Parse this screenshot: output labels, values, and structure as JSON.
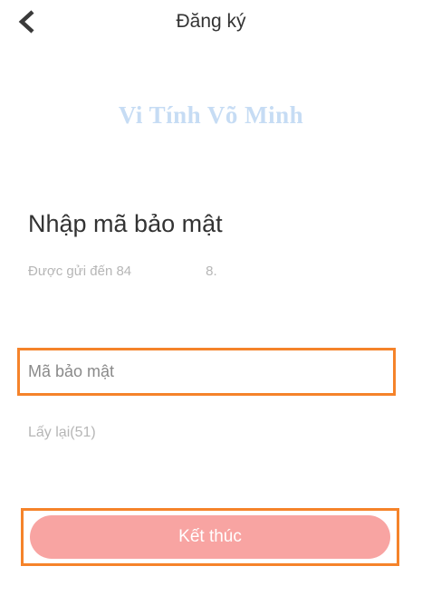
{
  "header": {
    "title": "Đăng ký",
    "back_icon": "chevron-left-icon"
  },
  "watermark": {
    "text": "Vi Tính Võ Minh",
    "color": "#c6dcf4"
  },
  "main": {
    "heading": "Nhập mã bảo mật",
    "sent_to_prefix": "Được gửi đến 84",
    "sent_to_suffix": "8.",
    "code_input": {
      "placeholder": "Mã bảo mật",
      "value": ""
    },
    "resend_label": "Lấy lại(51)",
    "finish_label": "Kết thúc"
  },
  "colors": {
    "highlight": "#f5832a",
    "button": "#f8a4a2",
    "button_text": "#ffffff"
  }
}
